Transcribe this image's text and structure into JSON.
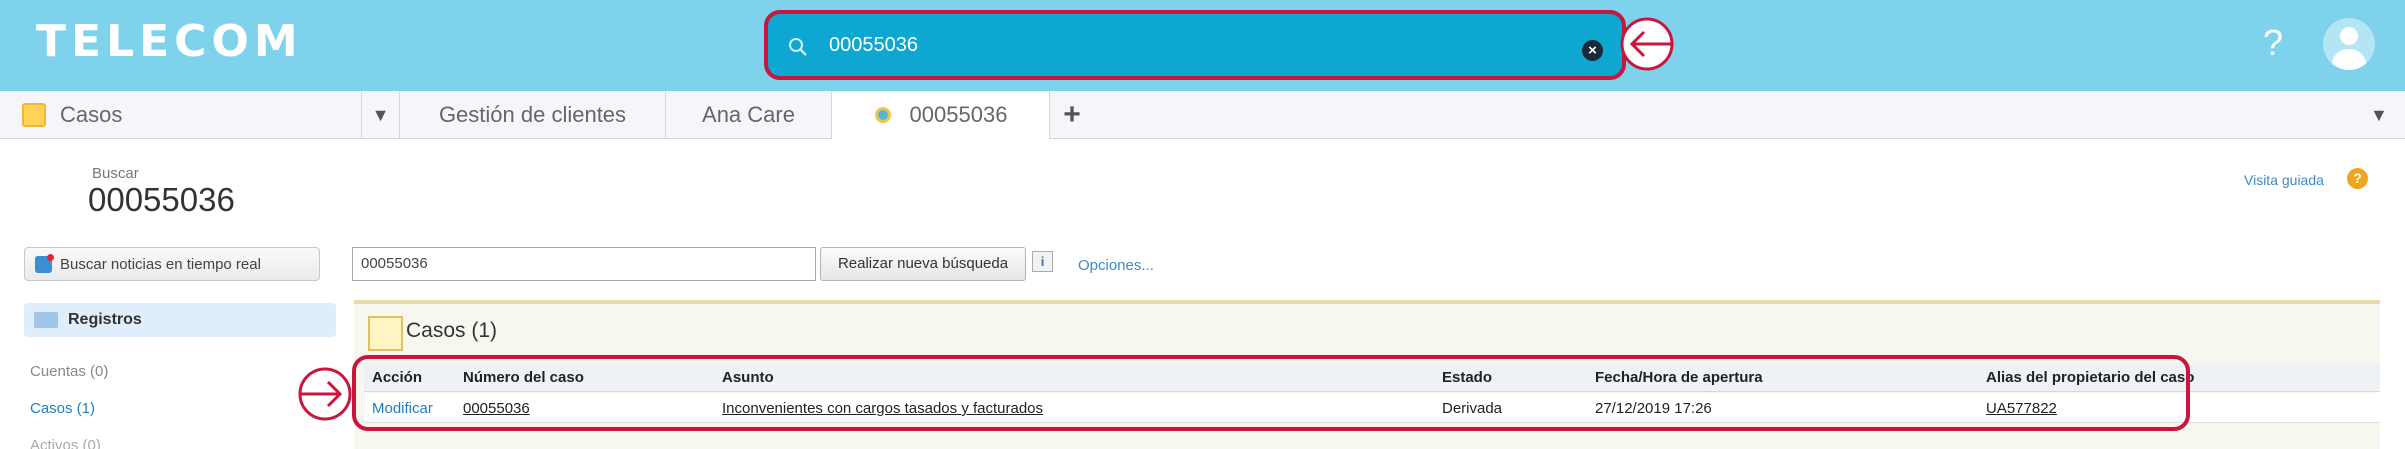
{
  "header": {
    "brand": "TELECOM",
    "search_value": "00055036",
    "bg_color": "#7fd2ec",
    "search_bg_color": "#0ea7d2",
    "highlight_color": "#c8163c",
    "help_label": "?"
  },
  "tabs": [
    {
      "label": "Casos",
      "icon": "case-folder-icon"
    },
    {
      "label": "Gestión de clientes"
    },
    {
      "label": "Ana Care"
    },
    {
      "label": "00055036",
      "icon": "search-result-icon",
      "active": true
    }
  ],
  "page": {
    "label": "Buscar",
    "title": "00055036",
    "tour_link": "Visita guiada"
  },
  "sidebar": {
    "realtime_button": "Buscar noticias en tiempo real",
    "records_label": "Registros",
    "items": [
      {
        "label": "Cuentas (0)"
      },
      {
        "label": "Casos (1)"
      },
      {
        "label": "Activos (0)"
      }
    ]
  },
  "search": {
    "value": "00055036",
    "button": "Realizar nueva búsqueda",
    "info": "i",
    "options_link": "Opciones..."
  },
  "results": {
    "title": "Casos (1)",
    "columns": [
      "Acción",
      "Número del caso",
      "Asunto",
      "Estado",
      "Fecha/Hora de apertura",
      "Alias del propietario del caso"
    ],
    "row": {
      "action": "Modificar",
      "case_number": "00055036",
      "subject": "Inconvenientes con cargos tasados y facturados",
      "status": "Derivada",
      "opened": "27/12/2019 17:26",
      "owner_alias": "UA577822"
    }
  }
}
